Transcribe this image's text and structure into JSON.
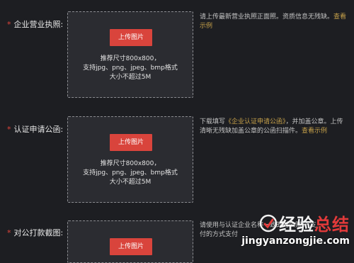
{
  "fields": [
    {
      "required_mark": "*",
      "label": "企业营业执照:",
      "upload_button": "上传图片",
      "box_lines": [
        "推荐尺寸800x800，",
        "支持jpg、png、jpeg、bmp格式",
        "大小不超过5M"
      ],
      "hint_text": "请上传最新营业执照正面照。资质信息无残缺。",
      "hint_link": "查看示例"
    },
    {
      "required_mark": "*",
      "label": "认证申请公函:",
      "upload_button": "上传图片",
      "box_lines": [
        "推荐尺寸800x800，",
        "支持jpg、png、jpeg、bmp格式",
        "大小不超过5M"
      ],
      "hint_prefix": "下载填写",
      "hint_doc_link": "《企业认证申请公函》",
      "hint_text": "，并加盖公章。上传清晰无残缺加盖公章的公函扫描件。",
      "hint_link": "查看示例"
    },
    {
      "required_mark": "*",
      "label": "对公打款截图:",
      "upload_button": "上传图片",
      "hint_text": "请使用与认证企业名称一致的对公账户 支付的方式支付"
    }
  ],
  "watermark": {
    "title_a": "经验",
    "title_b": "总结",
    "url": "jingyanzongjie.com"
  },
  "colors": {
    "background": "#1d1e22",
    "button": "#d9443c",
    "link": "#c8a24a",
    "required": "#e0443a"
  }
}
